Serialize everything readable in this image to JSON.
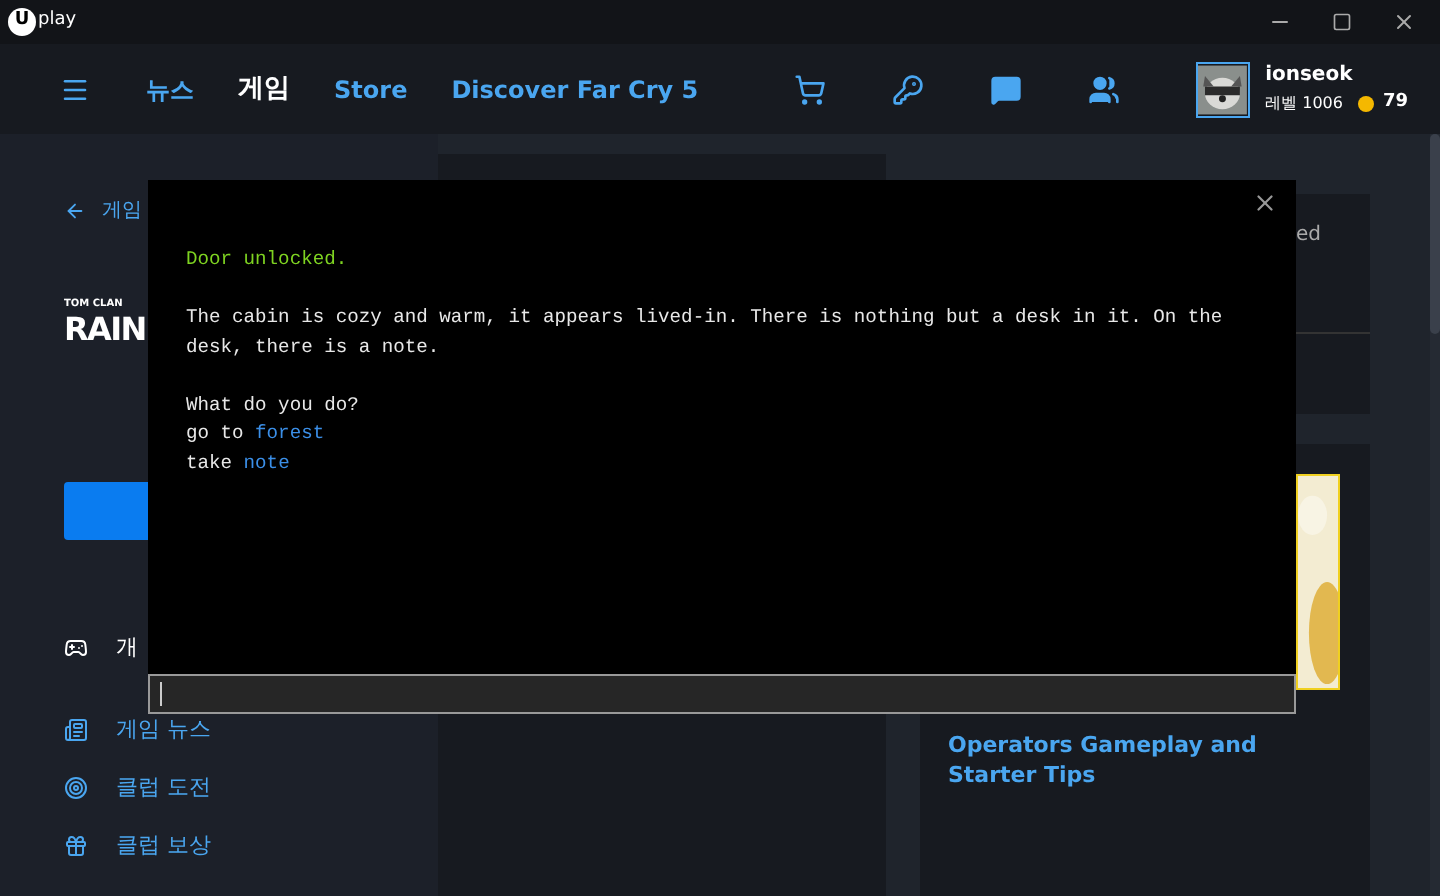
{
  "window": {
    "logo_mark": "U",
    "logo_text": "play"
  },
  "nav": {
    "items": [
      {
        "label": "뉴스",
        "selected": false
      },
      {
        "label": "게임",
        "selected": true
      },
      {
        "label": "Store",
        "selected": false
      },
      {
        "label": "Discover Far Cry 5",
        "selected": false
      }
    ]
  },
  "user": {
    "name": "ionseok",
    "level": "레벨 1006",
    "coins": "79"
  },
  "sidebar": {
    "back": "게임",
    "brand": "TOM CLAN",
    "logo": "RAIN",
    "items": [
      {
        "label": "개",
        "kind": "gamepad",
        "selected": true
      },
      {
        "label": "게임 뉴스",
        "kind": "news",
        "selected": false
      },
      {
        "label": "클럽 도전",
        "kind": "target",
        "selected": false
      },
      {
        "label": "클럽 보상",
        "kind": "gift",
        "selected": false
      }
    ]
  },
  "right": {
    "fragment": "ed",
    "article": "Operators Gameplay and Starter Tips"
  },
  "console": {
    "paragraphs": [
      [
        [
          {
            "text": "Door unlocked.",
            "kind": "status"
          }
        ]
      ],
      [
        [
          {
            "text": "The cabin is cozy and warm, it appears lived-in. There is nothing but a desk in it. On the",
            "kind": "plain"
          }
        ],
        [
          {
            "text": "desk, there is a note.",
            "kind": "plain"
          }
        ]
      ],
      [
        [
          {
            "text": "What do you do?",
            "kind": "plain"
          }
        ],
        [
          {
            "text": "go to ",
            "kind": "plain"
          },
          {
            "text": "forest",
            "kind": "link"
          }
        ],
        [
          {
            "text": "take ",
            "kind": "plain"
          },
          {
            "text": "note",
            "kind": "link"
          }
        ]
      ]
    ]
  }
}
